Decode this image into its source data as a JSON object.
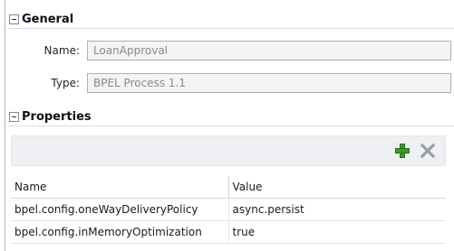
{
  "general": {
    "header": "General",
    "name_label": "Name:",
    "name_value": "LoanApproval",
    "type_label": "Type:",
    "type_value": "BPEL Process 1.1"
  },
  "properties": {
    "header": "Properties",
    "add_icon": "add-icon",
    "delete_icon": "delete-icon",
    "columns": [
      "Name",
      "Value"
    ],
    "rows": [
      {
        "name": "bpel.config.oneWayDeliveryPolicy",
        "value": "async.persist"
      },
      {
        "name": "bpel.config.inMemoryOptimization",
        "value": "true"
      }
    ]
  },
  "colors": {
    "add_green": "#3a9a2a",
    "delete_gray": "#9aa0a6"
  }
}
